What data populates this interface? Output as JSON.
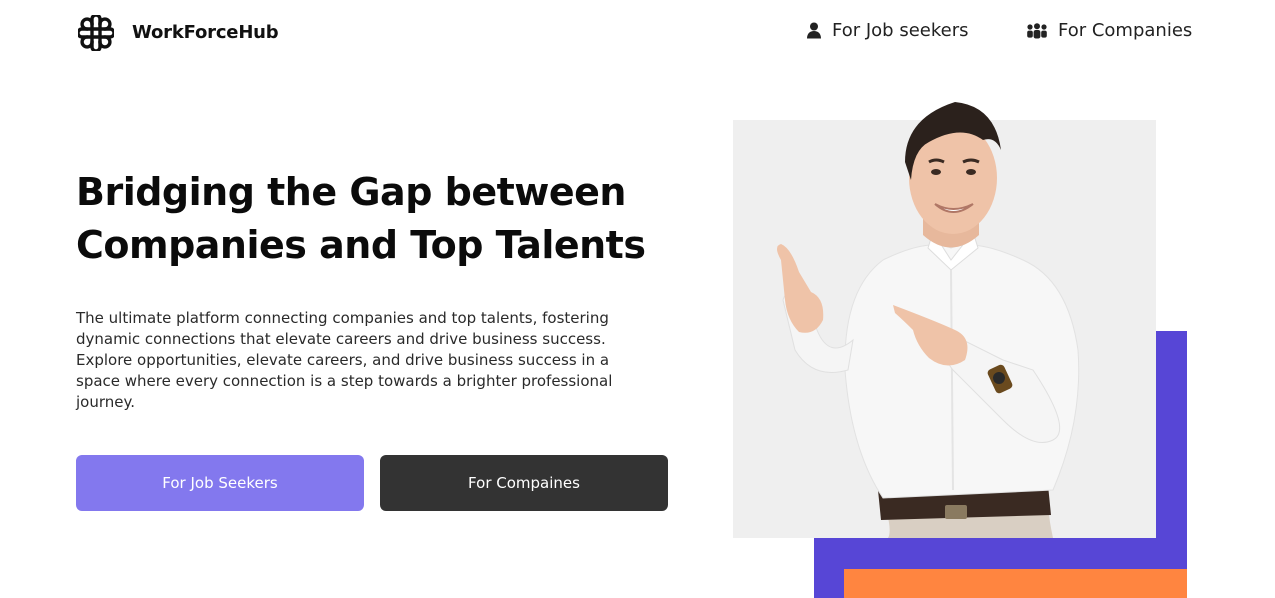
{
  "header": {
    "brand": "WorkForceHub",
    "nav": {
      "job_seekers": "For Job seekers",
      "companies": "For Companies"
    },
    "icons": {
      "logo": "workforcehub-logo-icon",
      "job_seekers": "person-icon",
      "companies": "group-icon"
    }
  },
  "hero": {
    "headline_line1": "Bridging the Gap between",
    "headline_line2": "Companies and Top Talents",
    "description": "The ultimate platform connecting companies and top talents, fostering dynamic connections that elevate careers and drive business success. Explore opportunities, elevate careers, and drive business success in a space where every connection is a step towards a brighter professional journey.",
    "buttons": {
      "job_seekers": "For Job Seekers",
      "companies": "For Compaines"
    },
    "image": "smiling-man-pointing-photo"
  },
  "colors": {
    "accent_purple": "#8378ee",
    "dark_button": "#333333",
    "block_purple": "#5746d6",
    "block_orange": "#ff8540",
    "photo_bg": "#efefef"
  }
}
